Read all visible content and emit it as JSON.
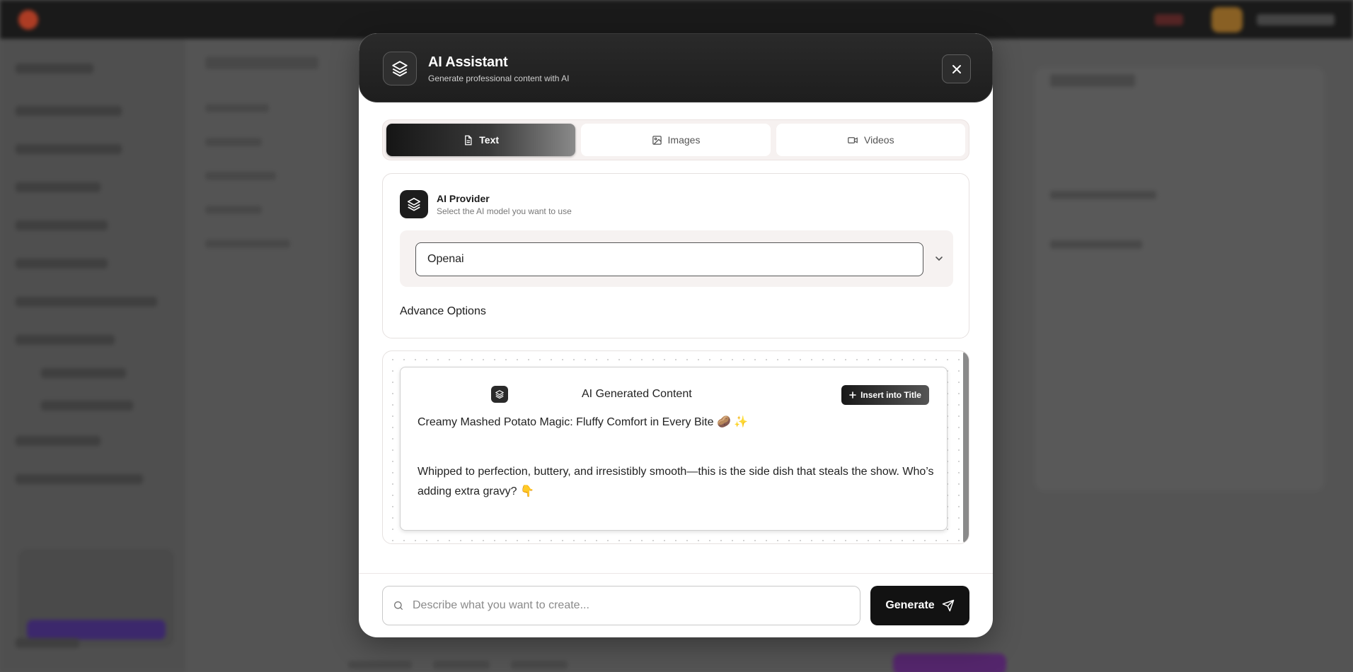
{
  "background": {
    "note_hidden": ""
  },
  "modal": {
    "title": "AI Assistant",
    "subtitle": "Generate professional content with AI",
    "close_icon": "close-icon",
    "header_icon": "layers-icon"
  },
  "tabs": [
    {
      "label": "Text",
      "icon": "document-icon",
      "active": true
    },
    {
      "label": "Images",
      "icon": "image-icon",
      "active": false
    },
    {
      "label": "Videos",
      "icon": "video-icon",
      "active": false
    }
  ],
  "provider": {
    "title": "AI Provider",
    "subtitle": "Select the AI model you want to use",
    "selected": "Openai",
    "advance_label": "Advance Options"
  },
  "generated": {
    "title": "AI Generated Content",
    "insert_label": "Insert into Title",
    "headline": "Creamy Mashed Potato Magic: Fluffy Comfort in Every Bite 🥔 ✨",
    "body": "Whipped to perfection, buttery, and irresistibly smooth—this is the side dish that steals the show. Who’s adding extra gravy? 👇"
  },
  "prompt": {
    "placeholder": "Describe what you want to create...",
    "value": ""
  },
  "generate": {
    "label": "Generate"
  },
  "colors": {
    "header_bg": "#1e1e1e",
    "accent": "#121212",
    "panel_tint": "#f6f2f1"
  }
}
